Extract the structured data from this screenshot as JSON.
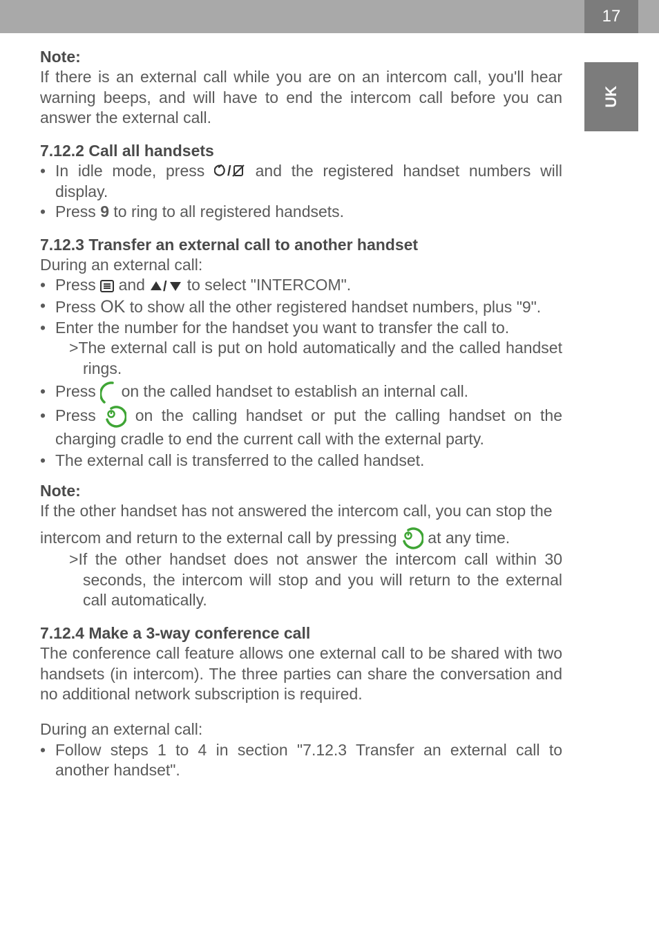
{
  "page_number": "17",
  "side_tab": "UK",
  "note1_head": "Note:",
  "note1_body": "If there is an external call while you are on an intercom call, you'll hear warning beeps, and will have to end the intercom call before you can answer the external call.",
  "s7122_head": "7.12.2  Call all handsets",
  "s7122_b1a": "In idle mode, press ",
  "s7122_b1b": " and the registered handset numbers will display.",
  "s7122_b2a": "Press ",
  "s7122_b2_key": "9",
  "s7122_b2b": " to ring to all registered handsets.",
  "s7123_head": "7.12.3  Transfer an external call to another handset",
  "s7123_intro": "During an external call:",
  "s7123_b1a": "Press ",
  "s7123_b1b": " and ",
  "s7123_b1c": " to select \"INTERCOM\".",
  "s7123_b2a": "Press ",
  "s7123_b2_ok": "OK",
  "s7123_b2b": " to show all the other registered handset numbers, plus \"9\".",
  "s7123_b3": "Enter the number for the handset you want to transfer the call to.",
  "s7123_b3_sub": "The external call is put on hold automatically and the called handset rings.",
  "s7123_b4a": "Press ",
  "s7123_b4b": " on the called handset to establish an internal call.",
  "s7123_b5a": "Press ",
  "s7123_b5b": " on the calling handset or put the calling handset on the charging cradle to end the current call with the external party.",
  "s7123_b6": "The external call is transferred to the called handset.",
  "note2_head": "Note:",
  "note2_p1": "If the other handset has not answered the intercom call, you can stop the",
  "note2_p2a": "intercom and return to the external call by pressing ",
  "note2_p2b": " at any time.",
  "note2_sub": "If the other handset does not answer the intercom call within 30 seconds, the intercom will stop and you will return to the external call automatically.",
  "s7124_head": "7.12.4  Make a 3-way conference call",
  "s7124_body": "The conference call feature allows one external call to be shared with two handsets (in intercom). The three parties can share the conversation and no additional network subscription is required.",
  "s7124_during": "During an external call:",
  "s7124_b1": "Follow steps 1 to 4 in section \"7.12.3 Transfer an external call to another handset\"."
}
